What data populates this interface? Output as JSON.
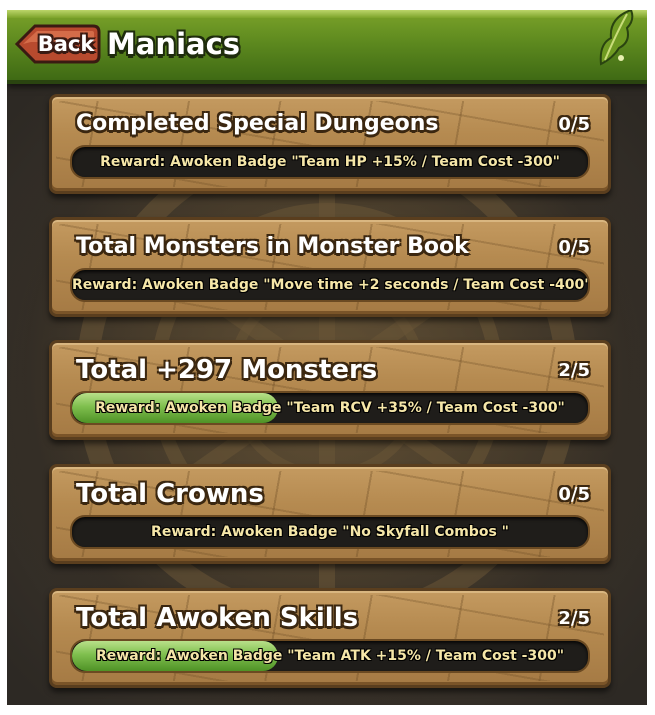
{
  "header": {
    "back_label": "Back",
    "title": "Maniacs",
    "accent": "#5e8a1f"
  },
  "missions": [
    {
      "title": "Completed Special Dungeons",
      "progress_text": "0/5",
      "progress_fraction": 0,
      "reward": "Reward: Awoken Badge \"Team HP +15%  / Team Cost -300\""
    },
    {
      "title": "Total Monsters in Monster Book",
      "progress_text": "0/5",
      "progress_fraction": 0,
      "reward": "Reward: Awoken Badge \"Move time +2 seconds / Team Cost -400\""
    },
    {
      "title": "Total +297 Monsters",
      "progress_text": "2/5",
      "progress_fraction": 0.4,
      "reward": "Reward: Awoken Badge \"Team RCV +35% / Team Cost -300\""
    },
    {
      "title": "Total Crowns",
      "progress_text": "0/5",
      "progress_fraction": 0,
      "reward": "Reward: Awoken Badge \"No Skyfall Combos \""
    },
    {
      "title": "Total Awoken Skills",
      "progress_text": "2/5",
      "progress_fraction": 0.4,
      "reward": "Reward: Awoken Badge \"Team ATK +15% / Team Cost -300\""
    }
  ],
  "colors": {
    "panel": "#b58a50",
    "progress_fill": "#7fbf4e",
    "reward_text": "#f5e6a8"
  },
  "icons": {
    "back": "back-arrow-icon",
    "corner": "leaf-icon"
  }
}
